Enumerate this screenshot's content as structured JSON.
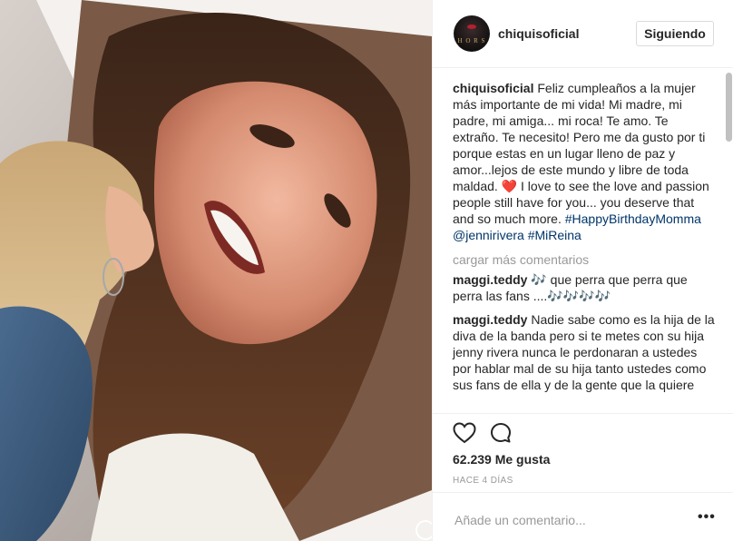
{
  "post": {
    "username": "chiquisoficial",
    "avatar_text": "H O R S",
    "follow_label": "Siguiendo"
  },
  "caption": {
    "username": "chiquisoficial",
    "text_part1": " Feliz cumpleaños a la mujer más importante de mi vida! Mi madre, mi padre, mi amiga... mi roca! Te amo. Te extraño. Te necesito! Pero me da gusto por ti porque estas en un lugar lleno de paz y amor...lejos de este mundo y libre de toda maldad. ",
    "heart": "❤️",
    "text_part2": " I love to see the love and passion people still have for you... you deserve that and so much more. ",
    "tag1": "#HappyBirthdayMomma",
    "mention": "@jennirivera",
    "tag2": "#MiReina"
  },
  "load_more": "cargar más comentarios",
  "comments": [
    {
      "user": "maggi.teddy",
      "text": " 🎶 que perra que perra que perra las fans ....🎶🎶🎶🎶"
    },
    {
      "user": "maggi.teddy",
      "text": " Nadie sabe como es la hija de la diva de la banda pero si te metes con su hija jenny rivera nunca le perdonaran a ustedes por hablar mal de su hija tanto ustedes como sus fans de ella y de la gente que la quiere"
    }
  ],
  "actions": {
    "like_icon": "heart-outline-icon",
    "comment_icon": "speech-bubble-icon"
  },
  "likes": "62.239 Me gusta",
  "time": "HACE 4 DÍAS",
  "add_comment_placeholder": "Añade un comentario...",
  "more_options": "•••"
}
